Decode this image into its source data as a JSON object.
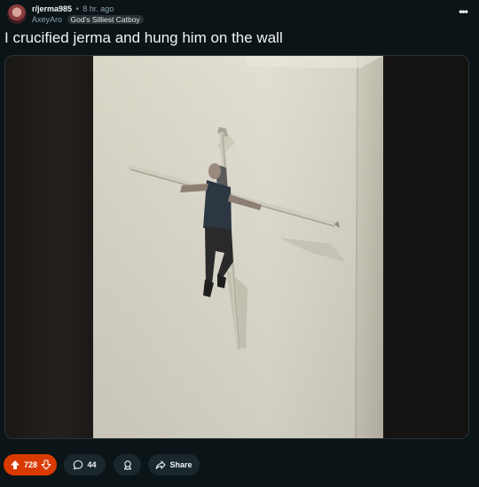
{
  "post": {
    "subreddit": "r/jerma985",
    "separator": "•",
    "time_ago": "8 hr. ago",
    "username": "AxeyAro",
    "flair": "God's Silliest Catboy",
    "more_label": "•••",
    "title": "I crucified jerma and hung him on the wall"
  },
  "actions": {
    "upvotes": "728",
    "comments": "44",
    "share_label": "Share"
  },
  "icons": {
    "avatar": "subreddit-avatar",
    "upvote": "upvote-arrow-icon",
    "downvote": "downvote-arrow-icon",
    "comment": "comment-bubble-icon",
    "award": "award-icon",
    "share": "share-arrow-icon",
    "more": "more-options-icon"
  },
  "colors": {
    "background": "#0b1416",
    "upvote_active": "#d93a00",
    "pill": "#1a282d",
    "muted_text": "#8ba2ad"
  }
}
